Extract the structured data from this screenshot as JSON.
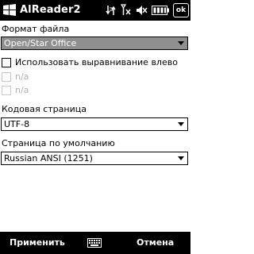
{
  "titlebar": {
    "app_title": "AlReader2",
    "ok_label": "ok",
    "icons": [
      "windows-logo-icon",
      "data-transfer-icon",
      "signal-off-icon",
      "speaker-muted-icon",
      "battery-icon"
    ]
  },
  "form": {
    "file_format": {
      "label": "Формат файла",
      "value": "Open/Star Office"
    },
    "align_left": {
      "label": "Использовать выравнивание влево",
      "checked": false
    },
    "na_option_1": {
      "label": "n/a",
      "checked": false,
      "disabled": true
    },
    "na_option_2": {
      "label": "n/a",
      "checked": false,
      "disabled": true
    },
    "code_page": {
      "label": "Кодовая страница",
      "value": "UTF-8"
    },
    "default_page": {
      "label": "Страница по умолчанию",
      "value": "Russian ANSI (1251)"
    }
  },
  "bottombar": {
    "left_label": "Применить",
    "right_label": "Отмена",
    "center_icon": "keyboard-icon"
  },
  "colors": {
    "bar_background": "#000000",
    "selected_dropdown": "#8f8f8f"
  }
}
